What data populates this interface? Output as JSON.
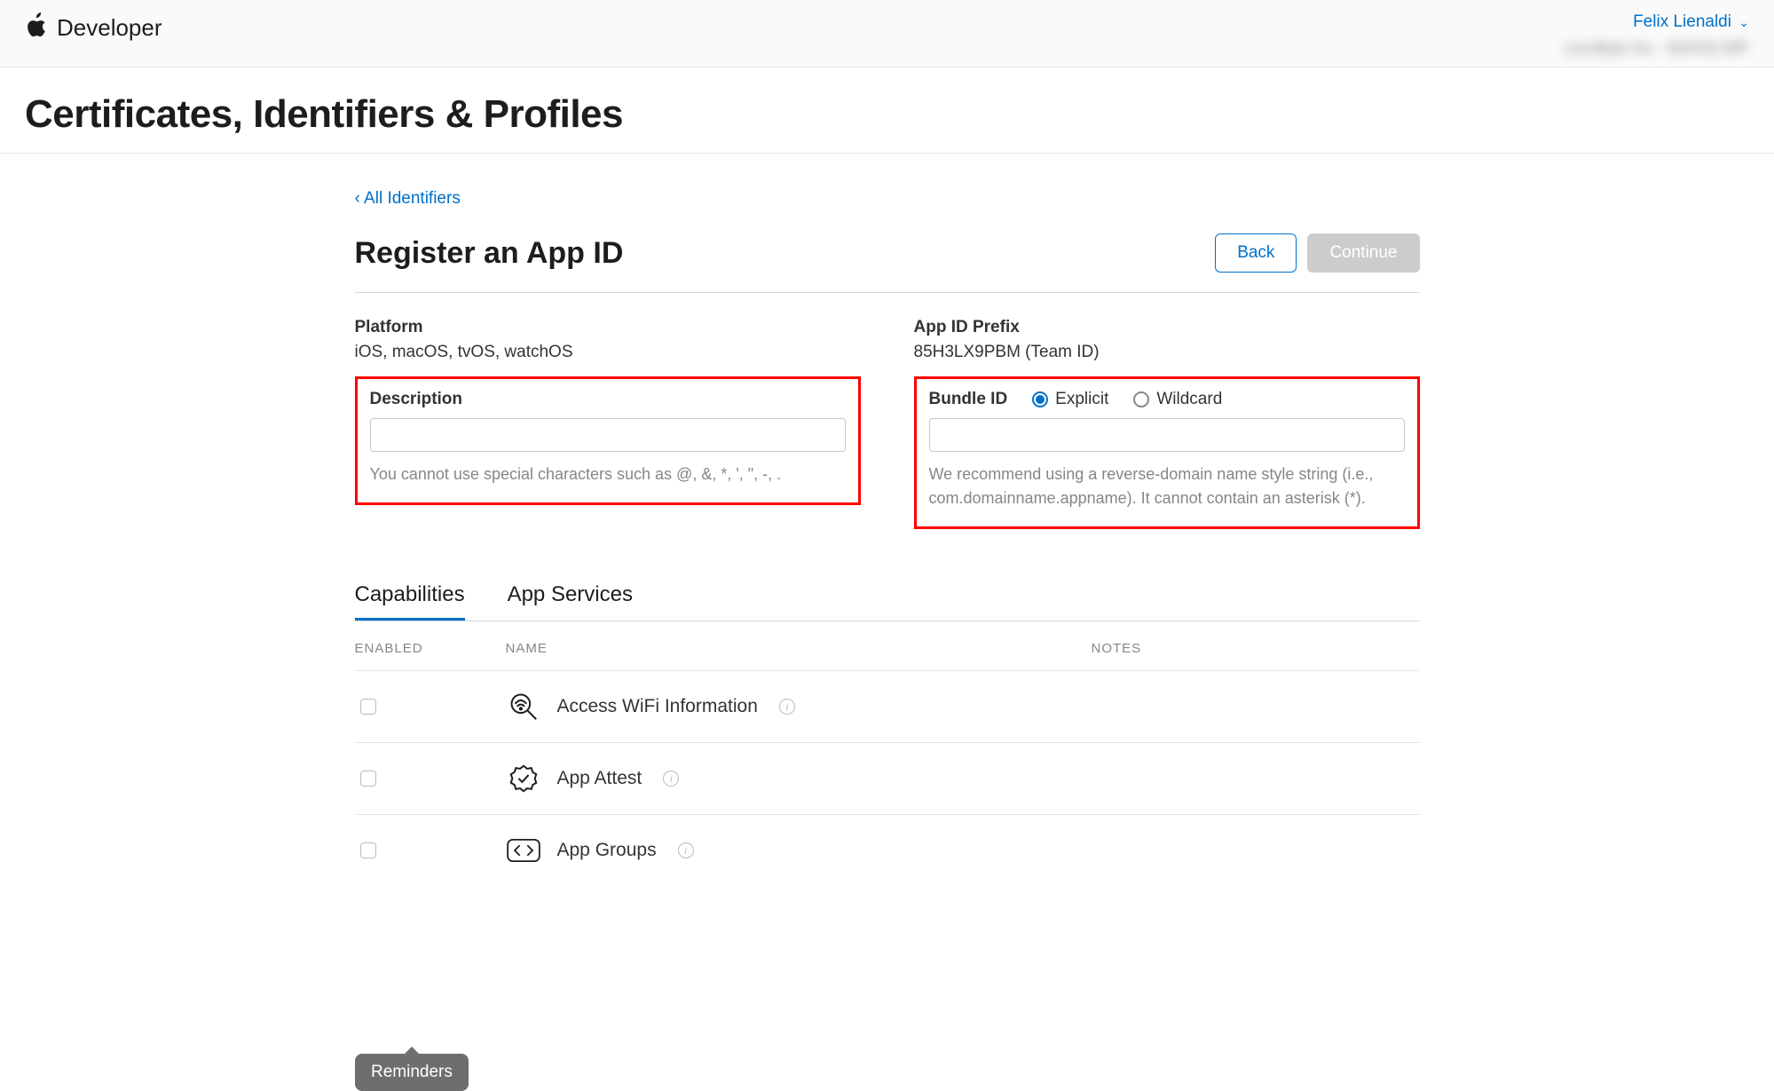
{
  "header": {
    "brand": "Developer",
    "account_name": "Felix Lienaldi",
    "team_blurred": "xxxxByte Inc - BSH3LX9P"
  },
  "page": {
    "title": "Certificates, Identifiers & Profiles",
    "back_link": "‹ All Identifiers",
    "section_title": "Register an App ID",
    "back_button": "Back",
    "continue_button": "Continue"
  },
  "platform": {
    "label": "Platform",
    "value": "iOS, macOS, tvOS, watchOS"
  },
  "app_id_prefix": {
    "label": "App ID Prefix",
    "value": "85H3LX9PBM (Team ID)"
  },
  "description": {
    "label": "Description",
    "value": "",
    "help": "You cannot use special characters such as @, &, *, ', \", -, ."
  },
  "bundle_id": {
    "label": "Bundle ID",
    "explicit": "Explicit",
    "wildcard": "Wildcard",
    "value": "",
    "help": "We recommend using a reverse-domain name style string (i.e., com.domainname.appname). It cannot contain an asterisk (*)."
  },
  "tabs": {
    "capabilities": "Capabilities",
    "app_services": "App Services"
  },
  "table": {
    "enabled": "ENABLED",
    "name": "NAME",
    "notes": "NOTES"
  },
  "capabilities": [
    {
      "name": "Access WiFi Information",
      "icon": "wifi-search"
    },
    {
      "name": "App Attest",
      "icon": "badge-check"
    },
    {
      "name": "App Groups",
      "icon": "arrows-exchange"
    }
  ],
  "tooltip": "Reminders"
}
